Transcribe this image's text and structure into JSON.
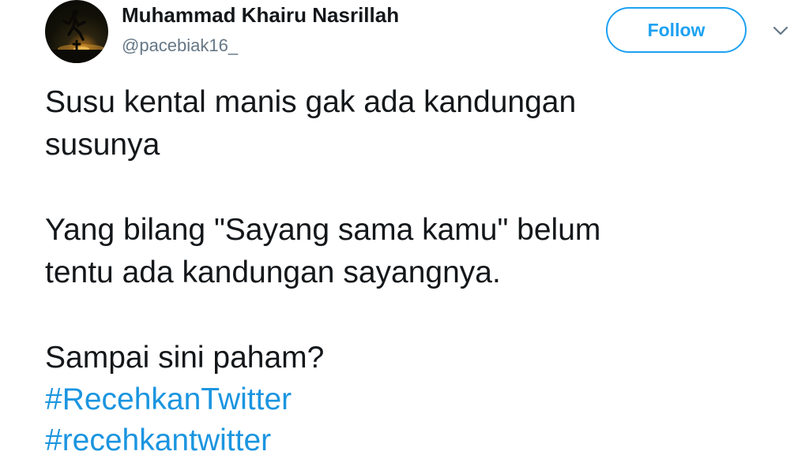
{
  "user": {
    "name": "Muhammad Khairu Nasrillah",
    "handle": "@pacebiak16_"
  },
  "header": {
    "follow_label": "Follow",
    "more_icon": "chevron-down-icon"
  },
  "tweet": {
    "lines": [
      "Susu kental manis gak ada kandungan",
      "susunya",
      "Yang bilang \"Sayang sama kamu\" belum",
      "tentu ada kandungan sayangnya.",
      "Sampai sini paham?"
    ],
    "hashtags": [
      "#RecehkanTwitter",
      "#recehkantwitter"
    ]
  },
  "colors": {
    "accent": "#1da1f2",
    "hashtag": "#1b95e0",
    "text": "#14171a",
    "muted": "#657786"
  }
}
